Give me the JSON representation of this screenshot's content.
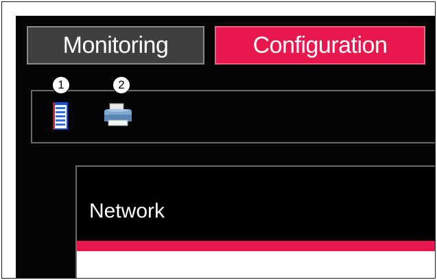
{
  "tabs": [
    {
      "label": "Monitoring",
      "active": false
    },
    {
      "label": "Configuration",
      "active": true
    }
  ],
  "toolbar": {
    "icons": [
      {
        "name": "document-icon",
        "callout": "1"
      },
      {
        "name": "printer-icon",
        "callout": "2"
      }
    ]
  },
  "content": {
    "section_title": "Network"
  },
  "colors": {
    "accent": "#e8174d",
    "background": "#050505",
    "inactive_tab": "#3f3f3f"
  }
}
